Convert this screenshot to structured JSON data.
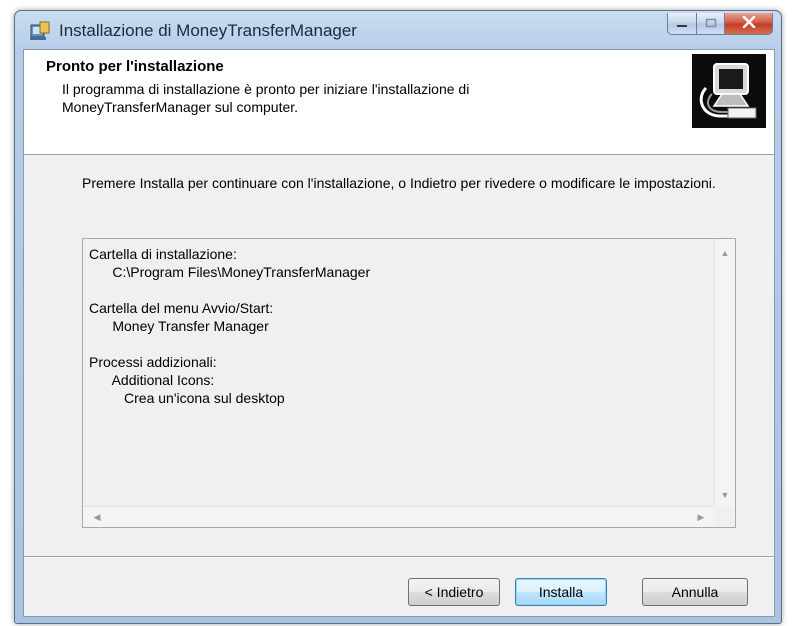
{
  "window": {
    "title": "Installazione di MoneyTransferManager"
  },
  "header": {
    "title": "Pronto per l'installazione",
    "description": "Il programma di installazione è pronto per iniziare l'installazione di MoneyTransferManager sul computer."
  },
  "body": {
    "instruction": "Premere Installa per continuare con l'installazione, o Indietro per rivedere o modificare le impostazioni."
  },
  "summary": {
    "lines": [
      "Cartella di installazione:",
      "      C:\\Program Files\\MoneyTransferManager",
      "",
      "Cartella del menu Avvio/Start:",
      "      Money Transfer Manager",
      "",
      "Processi addizionali:",
      "      Additional Icons:",
      "         Crea un'icona sul desktop"
    ]
  },
  "buttons": {
    "back": "< Indietro",
    "install": "Installa",
    "cancel": "Annulla"
  },
  "icons": {
    "app": "installer-icon",
    "header_image": "computer-install-icon",
    "minimize": "minimize-icon",
    "maximize": "maximize-icon",
    "close": "close-icon"
  },
  "colors": {
    "close_button": "#c23a22",
    "default_button_border": "#3c7fb1",
    "header_background": "#ffffff",
    "dialog_background": "#f0f0f0"
  }
}
